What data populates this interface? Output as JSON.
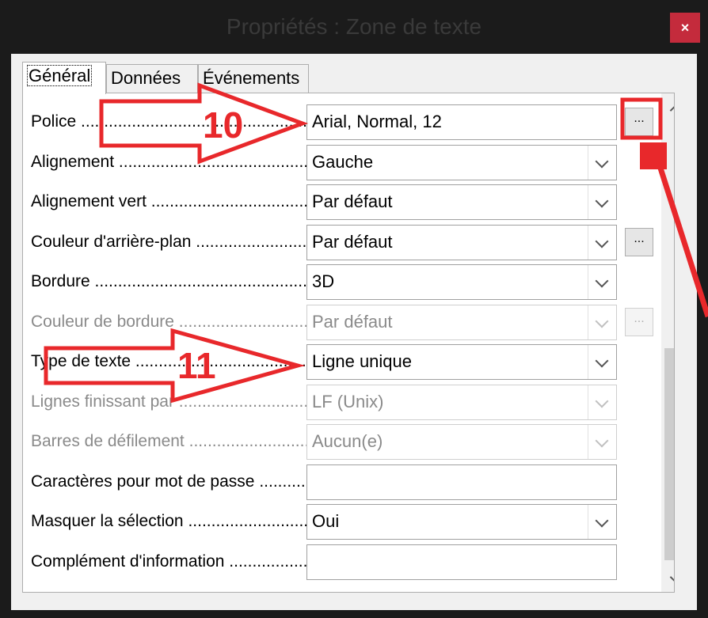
{
  "window": {
    "title": "Propriétés : Zone de texte",
    "close_label": "×"
  },
  "tabs": [
    {
      "label": "Général",
      "active": true
    },
    {
      "label": "Données",
      "active": false
    },
    {
      "label": "Événements",
      "active": false
    }
  ],
  "rows": [
    {
      "label": "Police",
      "value": "Arial, Normal, 12",
      "type": "text",
      "disabled": false,
      "button": "..."
    },
    {
      "label": "Alignement",
      "value": "Gauche",
      "type": "dropdown",
      "disabled": false
    },
    {
      "label": "Alignement vert",
      "value": "Par défaut",
      "type": "dropdown",
      "disabled": false
    },
    {
      "label": "Couleur d'arrière-plan",
      "value": "Par défaut",
      "type": "dropdown",
      "disabled": false,
      "button": "..."
    },
    {
      "label": "Bordure",
      "value": "3D",
      "type": "dropdown",
      "disabled": false
    },
    {
      "label": "Couleur de bordure",
      "value": "Par défaut",
      "type": "dropdown",
      "disabled": true,
      "button": "..."
    },
    {
      "label": "Type de texte",
      "value": "Ligne unique",
      "type": "dropdown",
      "disabled": false
    },
    {
      "label": "Lignes finissant par",
      "value": "LF (Unix)",
      "type": "dropdown",
      "disabled": true
    },
    {
      "label": "Barres de défilement",
      "value": "Aucun(e)",
      "type": "dropdown",
      "disabled": true
    },
    {
      "label": "Caractères pour mot de passe",
      "value": "",
      "type": "text",
      "disabled": false
    },
    {
      "label": "Masquer la sélection",
      "value": "Oui",
      "type": "dropdown",
      "disabled": false
    },
    {
      "label": "Complément d'information",
      "value": "",
      "type": "text",
      "disabled": false
    }
  ],
  "annotations": [
    {
      "number": "10",
      "target": "Police"
    },
    {
      "number": "11",
      "target": "Type de texte"
    }
  ],
  "colors": {
    "annotation": "#e8282b",
    "close_button": "#c42b3c",
    "title_bar": "#1b1b1b"
  },
  "icons": {
    "dropdown": "chevron-down-icon",
    "scroll_up": "chevron-up-icon",
    "scroll_down": "chevron-down-icon"
  }
}
